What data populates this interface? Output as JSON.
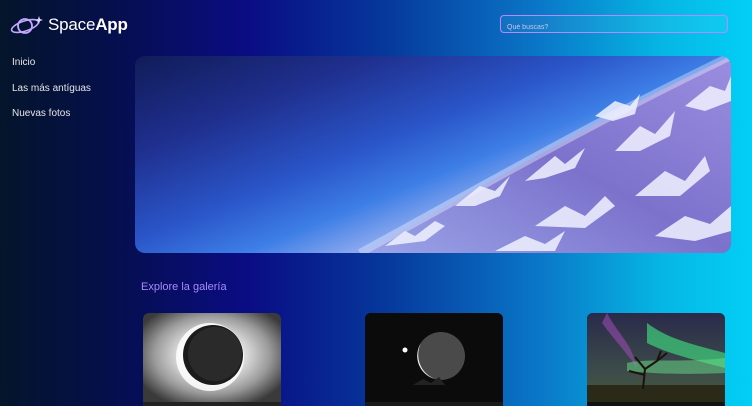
{
  "brand": {
    "name_light": "Space",
    "name_bold": "App",
    "logo_icon": "planet-icon"
  },
  "search": {
    "placeholder": "Qué buscas?"
  },
  "nav": [
    {
      "label": "Inicio"
    },
    {
      "label": "Las más antíguas"
    },
    {
      "label": "Nuevas fotos"
    }
  ],
  "gallery": {
    "title": "Explore la galería",
    "photos": [
      {
        "subject": "solar-eclipse"
      },
      {
        "subject": "crescent-moon"
      },
      {
        "subject": "aurora-tree"
      }
    ]
  },
  "colors": {
    "accent": "#a78bfa",
    "search_border": "#b58cff"
  }
}
